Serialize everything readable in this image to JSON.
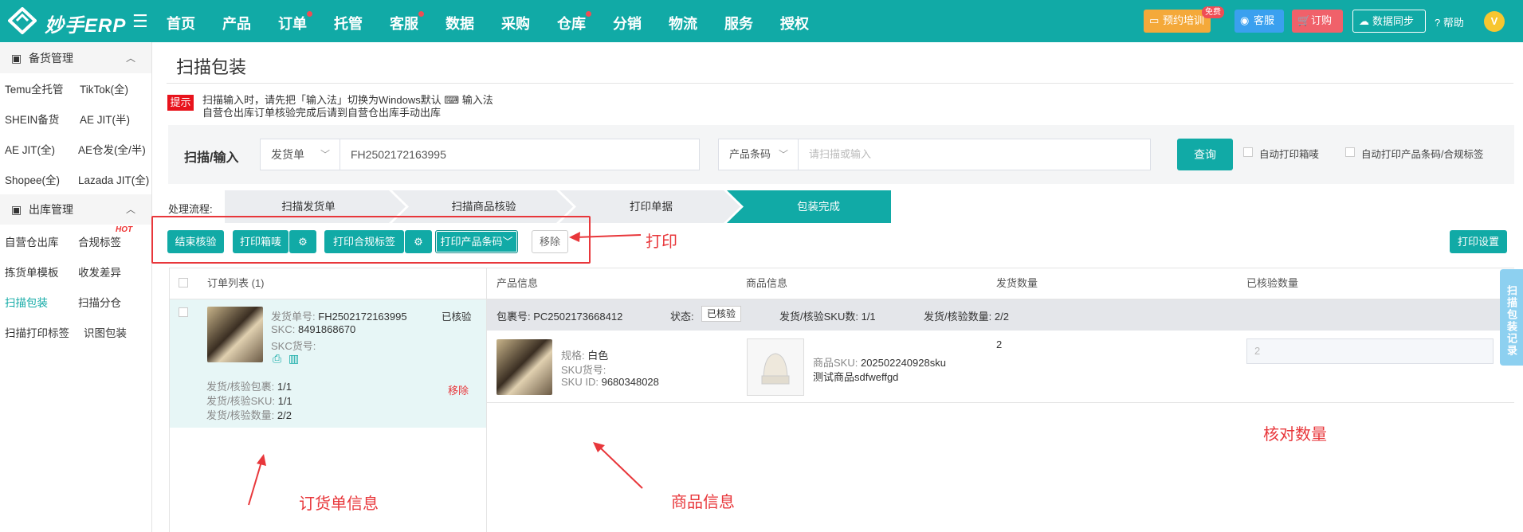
{
  "topbar": {
    "logo_text": "妙手ERP",
    "nav": [
      "首页",
      "产品",
      "订单",
      "托管",
      "客服",
      "数据",
      "采购",
      "仓库",
      "分销",
      "物流",
      "服务",
      "授权"
    ],
    "right": {
      "training": "预约培训",
      "training_badge": "免费",
      "service": "客服",
      "order": "订购",
      "sync": "数据同步",
      "help": "帮助",
      "avatar_letter": "V"
    }
  },
  "sidebar": {
    "section1": "备货管理",
    "items1": [
      "Temu全托管",
      "TikTok(全)",
      "SHEIN备货",
      "AE JIT(半)",
      "AE JIT(全)",
      "AE仓发(全/半)",
      "Shopee(全)",
      "Lazada JIT(全)"
    ],
    "section2": "出库管理",
    "items2": [
      "自营仓出库",
      "合规标签",
      "拣货单模板",
      "收发差异",
      "扫描包装",
      "扫描分仓",
      "扫描打印标签",
      "识图包装"
    ],
    "hot": "HOT"
  },
  "page": {
    "title": "扫描包装",
    "tip_badge": "提示",
    "tip_line1": "扫描输入时，请先把「输入法」切换为Windows默认 ⌨ 输入法",
    "tip_line2": "自营仓出库订单核验完成后请到自营仓出库手动出库",
    "scan_label": "扫描/输入",
    "select1": "发货单",
    "input1_value": "FH2502172163995",
    "select2": "产品条码",
    "input2_placeholder": "请扫描或输入",
    "query": "查询",
    "auto_box": "自动打印箱唛",
    "auto_label": "自动打印产品条码/合规标签",
    "flow_label": "处理流程:",
    "steps": [
      "扫描发货单",
      "扫描商品核验",
      "打印单据",
      "包装完成"
    ],
    "actions": {
      "finish": "结束核验",
      "print_box": "打印箱唛",
      "print_compliance": "打印合规标签",
      "print_barcode": "打印产品条码",
      "remove": "移除",
      "print_settings": "打印设置"
    },
    "annotations": {
      "print": "打印",
      "order_info": "订货单信息",
      "product_info": "商品信息",
      "check_qty": "核对数量"
    },
    "order_list": {
      "header": "订单列表 (1)",
      "order_no_label": "发货单号:",
      "order_no": "FH2502172163995",
      "status": "已核验",
      "skc_label": "SKC:",
      "skc": "8491868670",
      "skc_no_label": "SKC货号:",
      "stat1_label": "发货/核验包裹:",
      "stat1": "1/1",
      "stat2_label": "发货/核验SKU:",
      "stat2": "1/1",
      "stat3_label": "发货/核验数量:",
      "stat3": "2/2",
      "remove": "移除"
    },
    "table": {
      "headers": [
        "产品信息",
        "商品信息",
        "发货数量",
        "已核验数量"
      ],
      "pkg_label": "包裹号:",
      "pkg_no": "PC2502173668412",
      "state_label": "状态:",
      "state": "已核验",
      "sku_count_label": "发货/核验SKU数:",
      "sku_count": "1/1",
      "qty_label": "发货/核验数量:",
      "qty": "2/2",
      "spec_label": "规格:",
      "spec": "白色",
      "sku_no_label": "SKU货号:",
      "sku_id_label": "SKU ID:",
      "sku_id": "9680348028",
      "goods_sku_label": "商品SKU:",
      "goods_sku": "202502240928sku",
      "goods_name": "测试商品sdfweffgd",
      "ship_qty": "2",
      "checked_qty_placeholder": "2"
    },
    "side_tab": "扫描包装记录"
  }
}
